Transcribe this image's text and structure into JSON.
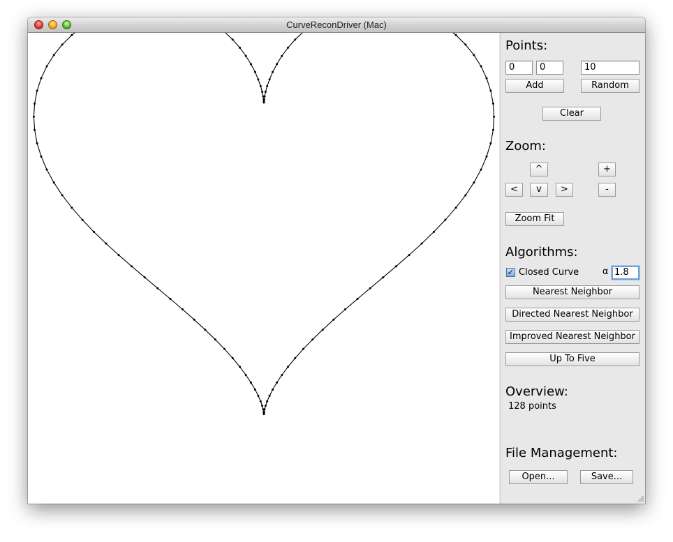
{
  "window": {
    "title": "CurveReconDriver (Mac)"
  },
  "points": {
    "heading": "Points:",
    "x_value": "0",
    "y_value": "0",
    "count_value": "10",
    "add_label": "Add",
    "random_label": "Random",
    "clear_label": "Clear"
  },
  "zoom": {
    "heading": "Zoom:",
    "up_label": "^",
    "left_label": "<",
    "down_label": "v",
    "right_label": ">",
    "zoom_in_label": "+",
    "zoom_out_label": "-",
    "fit_label": "Zoom Fit"
  },
  "algorithms": {
    "heading": "Algorithms:",
    "closed_curve_label": "Closed Curve",
    "closed_curve_checked": true,
    "alpha_symbol": "α",
    "alpha_value": "1.8",
    "nearest_neighbor_label": "Nearest Neighbor",
    "directed_label": "Directed Nearest Neighbor",
    "improved_label": "Improved Nearest Neighbor",
    "up_to_five_label": "Up To Five"
  },
  "overview": {
    "heading": "Overview:",
    "summary": "128 points"
  },
  "file": {
    "heading": "File Management:",
    "open_label": "Open...",
    "save_label": "Save..."
  },
  "curve": {
    "shape": "heart",
    "point_count": 128,
    "closed": true,
    "stroke_color": "#000000"
  },
  "colors": {
    "focus_ring": "#6f9ed8",
    "panel_bg": "#e8e8e8",
    "canvas_bg": "#ffffff"
  }
}
